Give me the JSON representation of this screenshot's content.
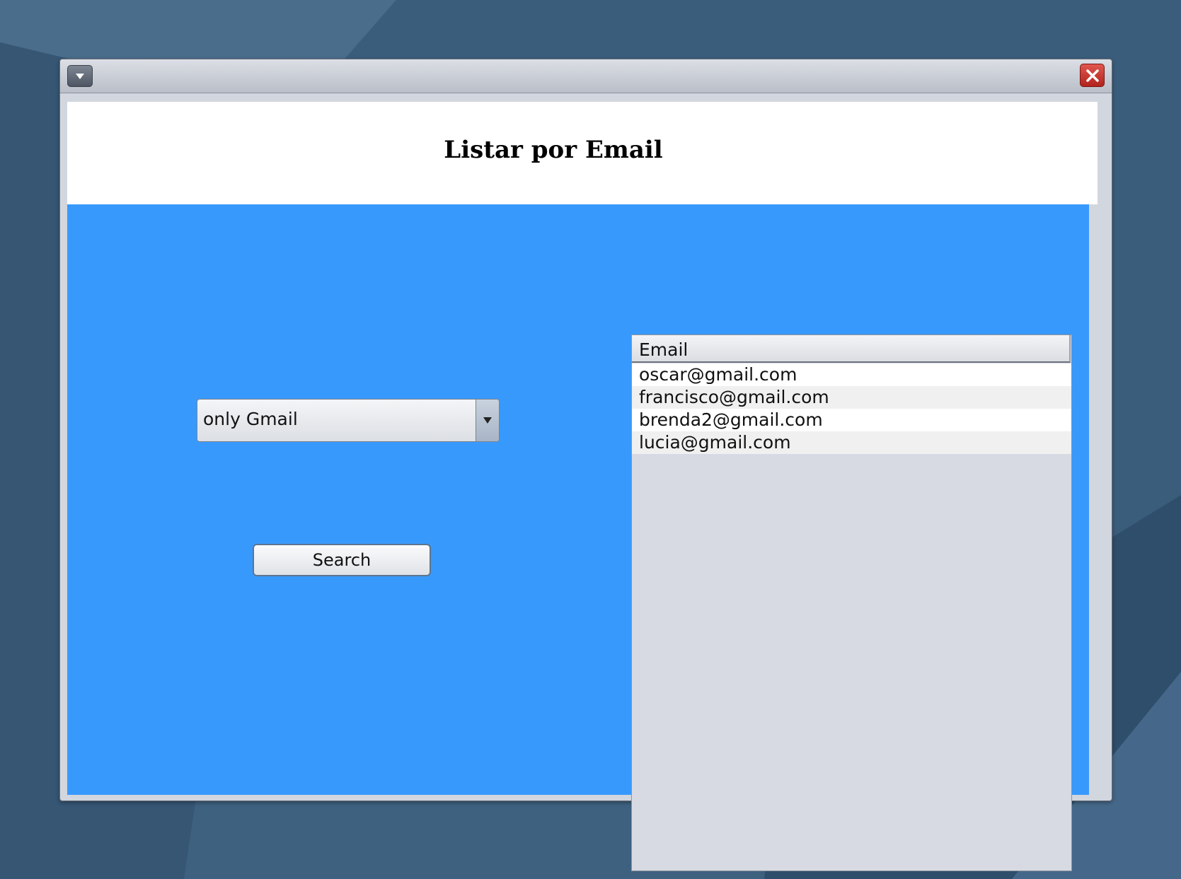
{
  "window": {
    "menu_icon": "chevron-down-icon",
    "close_icon": "close-icon"
  },
  "header": {
    "title": "Listar por Email"
  },
  "filter": {
    "selected": "only Gmail",
    "arrow_icon": "dropdown-arrow-icon"
  },
  "search_button": {
    "label": "Search"
  },
  "table": {
    "column_header": "Email",
    "rows": [
      "oscar@gmail.com",
      "francisco@gmail.com",
      "brenda2@gmail.com",
      "lucia@gmail.com"
    ]
  },
  "colors": {
    "panel_background": "#3899fd",
    "header_background": "#ffffff",
    "close_button": "#c8312a"
  }
}
